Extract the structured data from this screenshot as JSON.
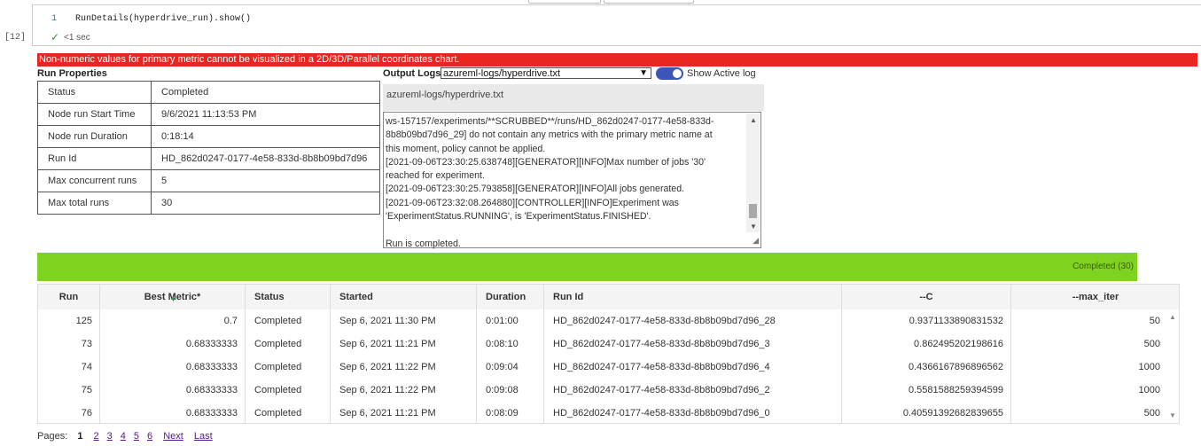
{
  "cell": {
    "line_number": "1",
    "code": "RunDetails(hyperdrive_run).show()",
    "execution_count": "[12]",
    "exec_status_icon": "check-icon",
    "exec_time": "<1 sec"
  },
  "error_message": "Non-numeric values for primary metric cannot be visualized in a 2D/3D/Parallel coordinates chart.",
  "run_properties": {
    "title": "Run Properties",
    "rows": [
      {
        "key": "Status",
        "value": "Completed"
      },
      {
        "key": "Node run Start Time",
        "value": "9/6/2021 11:13:53 PM"
      },
      {
        "key": "Node run Duration",
        "value": "0:18:14"
      },
      {
        "key": "Run Id",
        "value": "HD_862d0247-0177-4e58-833d-8b8b09bd7d96"
      },
      {
        "key": "Max concurrent runs",
        "value": "5"
      },
      {
        "key": "Max total runs",
        "value": "30"
      }
    ]
  },
  "output_logs": {
    "title": "Output Logs",
    "selected_file": "azureml-logs/hyperdrive.txt",
    "toggle_label": "Show Active log",
    "toggle_on": true,
    "file_header": "azureml-logs/hyperdrive.txt",
    "log_lines": [
      "ws-157157/experiments/**SCRUBBED**/runs/HD_862d0247-0177-4e58-833d-",
      "8b8b09bd7d96_29] do not contain any metrics with the primary metric name at",
      "this moment, policy cannot be applied.",
      "[2021-09-06T23:30:25.638748][GENERATOR][INFO]Max number of jobs '30'",
      "reached for experiment.",
      "[2021-09-06T23:30:25.793858][GENERATOR][INFO]All jobs generated.",
      "[2021-09-06T23:32:08.264880][CONTROLLER][INFO]Experiment was",
      "'ExperimentStatus.RUNNING', is 'ExperimentStatus.FINISHED'.",
      "",
      "Run is completed."
    ]
  },
  "progress": {
    "label": "Completed (30)",
    "color": "#7ed321",
    "completed_fraction": 1.0
  },
  "runs_table": {
    "columns": [
      "Run",
      "Best Metric*",
      "Status",
      "Started",
      "Duration",
      "Run Id",
      "--C",
      "--max_iter"
    ],
    "sorted_column": "Best Metric*",
    "rows": [
      [
        "125",
        "0.7",
        "Completed",
        "Sep 6, 2021 11:30 PM",
        "0:01:00",
        "HD_862d0247-0177-4e58-833d-8b8b09bd7d96_28",
        "0.9371133890831532",
        "50"
      ],
      [
        "73",
        "0.68333333",
        "Completed",
        "Sep 6, 2021 11:21 PM",
        "0:08:10",
        "HD_862d0247-0177-4e58-833d-8b8b09bd7d96_3",
        "0.862495202198616",
        "500"
      ],
      [
        "74",
        "0.68333333",
        "Completed",
        "Sep 6, 2021 11:22 PM",
        "0:09:04",
        "HD_862d0247-0177-4e58-833d-8b8b09bd7d96_4",
        "0.4366167896896562",
        "1000"
      ],
      [
        "75",
        "0.68333333",
        "Completed",
        "Sep 6, 2021 11:22 PM",
        "0:09:08",
        "HD_862d0247-0177-4e58-833d-8b8b09bd7d96_2",
        "0.5581588259394599",
        "1000"
      ],
      [
        "76",
        "0.68333333",
        "Completed",
        "Sep 6, 2021 11:21 PM",
        "0:08:09",
        "HD_862d0247-0177-4e58-833d-8b8b09bd7d96_0",
        "0.40591392682839655",
        "500"
      ]
    ]
  },
  "pagination": {
    "label": "Pages:",
    "current": "1",
    "pages": [
      "2",
      "3",
      "4",
      "5",
      "6"
    ],
    "next": "Next",
    "last": "Last"
  },
  "colors": {
    "error": "#e8261f",
    "toggle": "#3b55b8",
    "link": "#551a8b"
  }
}
